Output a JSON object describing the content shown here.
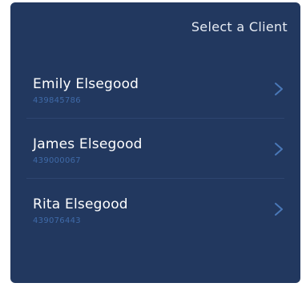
{
  "header": {
    "title": "Select a Client"
  },
  "clients": [
    {
      "name": "Emily Elsegood",
      "id": "439845786"
    },
    {
      "name": "James Elsegood",
      "id": "439000067"
    },
    {
      "name": "Rita Elsegood",
      "id": "439076443"
    }
  ],
  "icons": {
    "row_chevron": "chevron-right-icon"
  },
  "colors": {
    "panel_background": "#22385f",
    "client_id_text": "#3f6aa8",
    "chevron": "#4a78b8"
  }
}
